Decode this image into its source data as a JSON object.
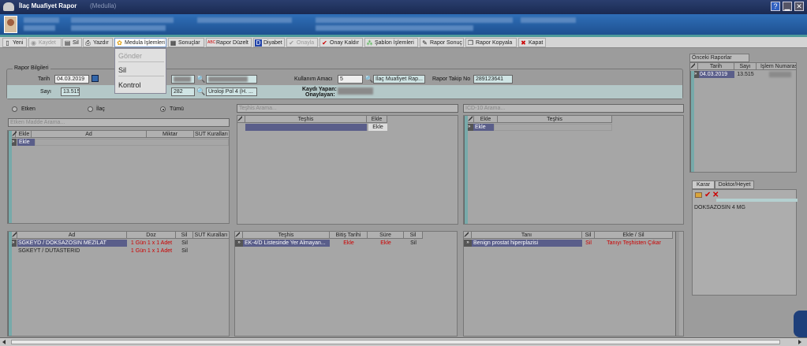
{
  "window": {
    "title": "İlaç Muafiyet Rapor",
    "subtitle": "(Medulla)"
  },
  "toolbar": {
    "items": [
      {
        "label": "Yeni",
        "icon": "new-icon"
      },
      {
        "label": "Kaydet",
        "icon": "save-icon"
      },
      {
        "label": "Sil",
        "icon": "delete-icon"
      },
      {
        "label": "Yazdır",
        "icon": "printer-icon"
      },
      {
        "label": "Medula İşlemleri",
        "icon": "medula-icon"
      },
      {
        "label": "Sonuçlar",
        "icon": "results-icon"
      },
      {
        "label": "Rapor Düzelt",
        "icon": "abc-edit-icon"
      },
      {
        "label": "Diyabet",
        "icon": "diabetes-icon"
      },
      {
        "label": "Onayla",
        "icon": "check-icon"
      },
      {
        "label": "Onay Kaldır",
        "icon": "uncheck-icon"
      },
      {
        "label": "Şablon İşlemleri",
        "icon": "template-icon"
      },
      {
        "label": "Rapor Sonuç",
        "icon": "report-result-icon"
      },
      {
        "label": "Rapor Kopyala",
        "icon": "copy-icon"
      },
      {
        "label": "Kapat",
        "icon": "close-icon"
      }
    ]
  },
  "medula_menu": {
    "items": [
      "Gönder",
      "Sil",
      "Kontrol"
    ]
  },
  "rapor_bilgileri": {
    "legend": "Rapor Bilgileri",
    "tarih_label": "Tarih",
    "tarih": "04.03.2019",
    "sayi_label": "Sayı",
    "sayi": "13.515",
    "code_value": "282",
    "code_text": "Üroloji Pol 4 (H. ...",
    "kullanim_label": "Kullanım Amacı",
    "kullanim_value": "5",
    "kullanim_text": "İlaç Muafiyet Rap...",
    "takip_label": "Rapor Takip No",
    "takip_no": "289123641",
    "kayit_label": "Kaydı Yapan:",
    "onay_label": "Onaylayan:"
  },
  "filter": {
    "options": [
      "Etken",
      "İlaç",
      "Tümü"
    ],
    "selected": "Tümü",
    "search_placeholder": "Etken Madde Arama..."
  },
  "teshis_search": "Teşhis Arama...",
  "icd_search": "ICD-10 Arama...",
  "grid_left_top": {
    "headers": [
      "Ekle",
      "Ad",
      "Miktar",
      "SUT Kuralları"
    ],
    "row": "Ekle"
  },
  "grid_mid_top": {
    "headers": [
      "Teşhis",
      "Ekle"
    ],
    "row": "Ekle"
  },
  "grid_right_top": {
    "headers": [
      "Ekle",
      "Teşhis"
    ],
    "row": "Ekle"
  },
  "grid_left_bottom": {
    "headers": [
      "Ad",
      "Doz",
      "Sil",
      "SUT Kuralları"
    ],
    "rows": [
      [
        "SGKEYD / DOKSAZOSIN MEZILAT",
        "1 Gün 1 x 1 Adet",
        "Sil"
      ],
      [
        "SGKEYT / DUTASTERID",
        "1 Gün 1 x 1 Adet",
        "Sil"
      ]
    ]
  },
  "grid_mid_bottom": {
    "headers": [
      "Teşhis",
      "Bitiş Tarihi",
      "Süre",
      "Sil"
    ],
    "rows": [
      [
        "EK-4/D Listesinde Yer Almayan...",
        "Ekle",
        "Ekle",
        "Sil"
      ]
    ]
  },
  "grid_right_bottom": {
    "headers": [
      "Tanı",
      "Sil",
      "Ekle / Sil"
    ],
    "rows": [
      [
        "Benign prostat hiperplazisi",
        "Sil",
        "Tanıyı Teşhisten Çıkar"
      ]
    ]
  },
  "onceki": {
    "title": "Önceki Raporlar",
    "headers": [
      "Tarih",
      "Sayı",
      "İşlem Numarası"
    ],
    "row": [
      "04.03.2019",
      "13.515"
    ]
  },
  "karar": {
    "tabs": [
      "Karar",
      "Doktor/Heyet"
    ],
    "text": "DOKSAZOSİN 4 MG"
  }
}
